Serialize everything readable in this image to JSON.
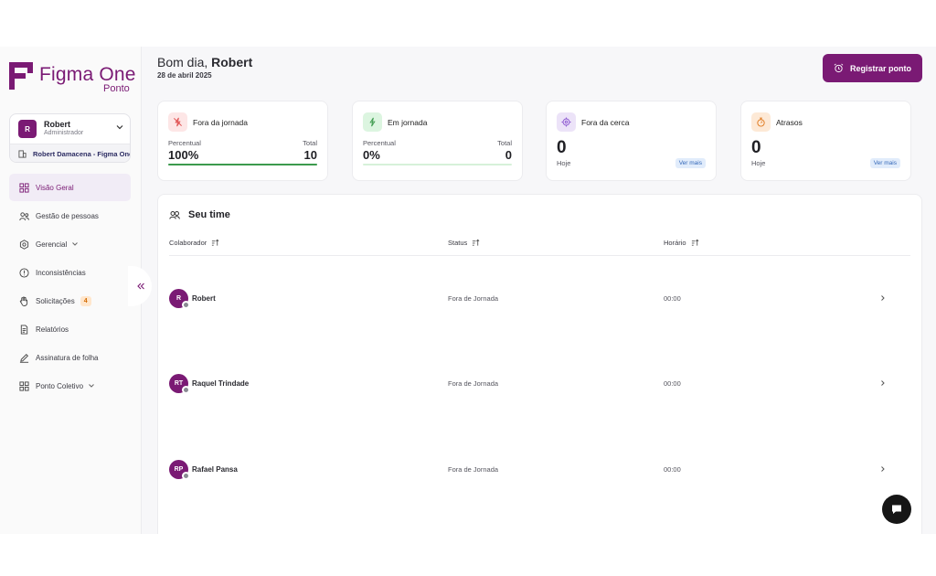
{
  "brand": {
    "name": "Figma One",
    "sub": "Ponto",
    "color": "#7a1a74"
  },
  "user": {
    "initial": "R",
    "name": "Robert",
    "role": "Administrador",
    "company": "Robert Damacena - Figma One"
  },
  "nav": [
    {
      "label": "Visão Geral",
      "icon": "grid-icon",
      "active": true
    },
    {
      "label": "Gestão de pessoas",
      "icon": "people-icon"
    },
    {
      "label": "Gerencial",
      "icon": "cog-icon",
      "has_chevron": true
    },
    {
      "label": "Inconsistências",
      "icon": "alert-circle-icon"
    },
    {
      "label": "Solicitações",
      "icon": "hand-icon",
      "badge": "4"
    },
    {
      "label": "Relatórios",
      "icon": "report-icon"
    },
    {
      "label": "Assinatura de folha",
      "icon": "pen-icon"
    },
    {
      "label": "Ponto Coletivo",
      "icon": "grid-icon",
      "has_chevron": true
    }
  ],
  "header": {
    "greeting_prefix": "Bom dia,",
    "greeting_name": "Robert",
    "date": "28 de abril 2025",
    "register_button": "Registrar ponto"
  },
  "stats": {
    "fora_jornada": {
      "title": "Fora da jornada",
      "left_label": "Percentual",
      "right_label": "Total",
      "left_value": "100%",
      "right_value": "10",
      "progress": 1.0,
      "icon": "off-duty-icon"
    },
    "em_jornada": {
      "title": "Em jornada",
      "left_label": "Percentual",
      "right_label": "Total",
      "left_value": "0%",
      "right_value": "0",
      "progress": 0.0,
      "icon": "lightning-icon"
    },
    "fora_cerca": {
      "title": "Fora da cerca",
      "value": "0",
      "sub": "Hoje",
      "link": "Ver mais",
      "icon": "target-icon"
    },
    "atrasos": {
      "title": "Atrasos",
      "value": "0",
      "sub": "Hoje",
      "link": "Ver mais",
      "icon": "stopwatch-icon"
    }
  },
  "team": {
    "title": "Seu time",
    "columns": {
      "collaborator": "Colaborador",
      "status": "Status",
      "time": "Horário"
    },
    "rows": [
      {
        "initials": "R",
        "name": "Robert",
        "status": "Fora de Jornada",
        "time": "00:00"
      },
      {
        "initials": "RT",
        "name": "Raquel Trindade",
        "status": "Fora de Jornada",
        "time": "00:00"
      },
      {
        "initials": "RP",
        "name": "Rafael Pansa",
        "status": "Fora de Jornada",
        "time": "00:00"
      }
    ]
  }
}
